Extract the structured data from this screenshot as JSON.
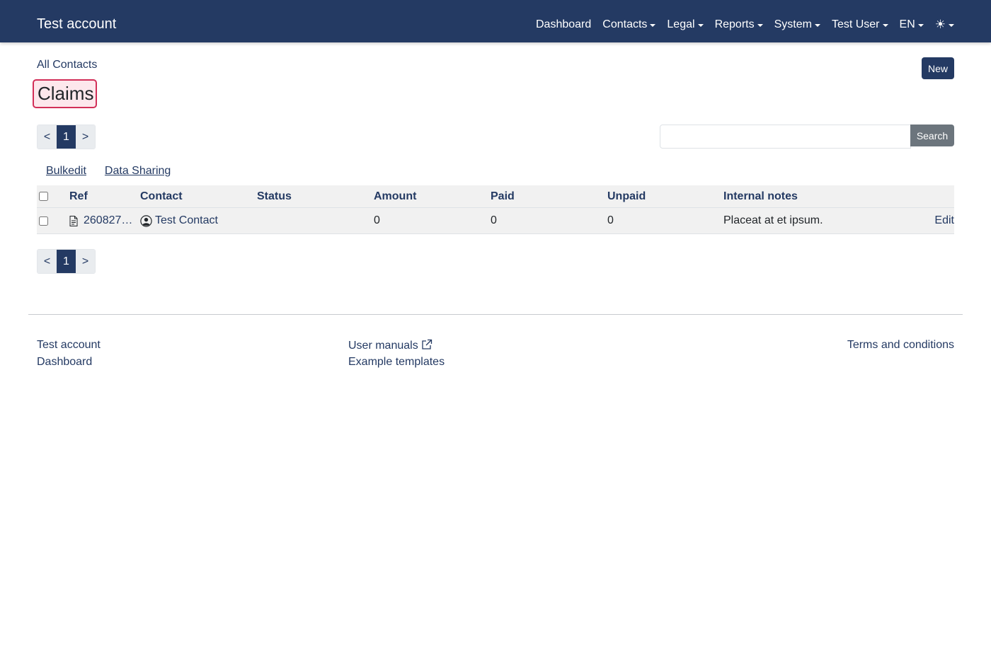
{
  "navbar": {
    "brand": "Test account",
    "items": [
      {
        "label": "Dashboard",
        "dropdown": false
      },
      {
        "label": "Contacts",
        "dropdown": true
      },
      {
        "label": "Legal",
        "dropdown": true
      },
      {
        "label": "Reports",
        "dropdown": true
      },
      {
        "label": "System",
        "dropdown": true
      },
      {
        "label": "Test User",
        "dropdown": true
      },
      {
        "label": "EN",
        "dropdown": true
      }
    ],
    "theme_toggle_icon": "sun-icon"
  },
  "page": {
    "breadcrumb": "All Contacts",
    "title": "Claims",
    "new_label": "New"
  },
  "pagination": {
    "prev": "<",
    "current": "1",
    "next": ">"
  },
  "search": {
    "value": "",
    "placeholder": "",
    "button_label": "Search"
  },
  "actions": {
    "bulkedit": "Bulkedit",
    "data_sharing": "Data Sharing"
  },
  "table": {
    "headers": {
      "ref": "Ref",
      "contact": "Contact",
      "status": "Status",
      "amount": "Amount",
      "paid": "Paid",
      "unpaid": "Unpaid",
      "notes": "Internal notes"
    },
    "rows": [
      {
        "ref": "260827…",
        "contact": "Test Contact",
        "status": "",
        "amount": "0",
        "paid": "0",
        "unpaid": "0",
        "notes": "Placeat at et ipsum.",
        "edit": "Edit"
      }
    ]
  },
  "footer": {
    "col1": [
      "Test account",
      "Dashboard"
    ],
    "col2": [
      "User manuals",
      "Example templates"
    ],
    "col3": [
      "Terms and conditions"
    ]
  },
  "colors": {
    "navbar": "#243a63",
    "accent": "#243a63",
    "title_highlight_border": "#d22f58",
    "search_button": "#6c757d"
  }
}
